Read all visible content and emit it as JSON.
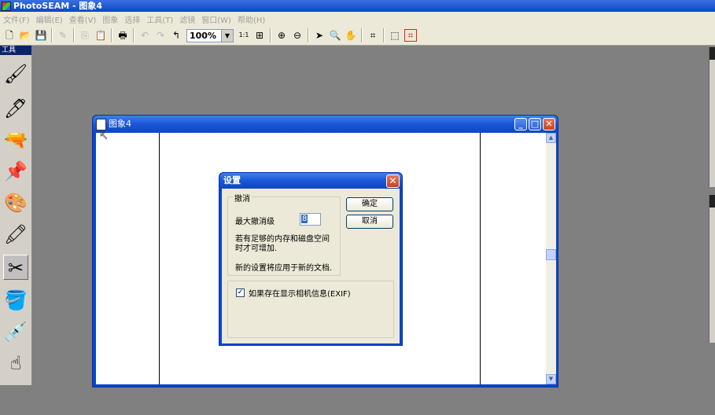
{
  "app": {
    "title": "PhotoSEAM - 图象4"
  },
  "menu": [
    "文件(F)",
    "编辑(E)",
    "查看(V)",
    "图象",
    "选择",
    "工具(T)",
    "滤镜",
    "窗口(W)",
    "帮助(H)"
  ],
  "toolbar": {
    "zoom": "100%",
    "actual_size_label": "1:1"
  },
  "tools_panel": {
    "title": "工具"
  },
  "document": {
    "title": "图象4"
  },
  "dialog": {
    "title": "设置",
    "undo_group": "撤消",
    "max_undo_label": "最大撤消级",
    "max_undo_value": "8",
    "note1_line1": "若有足够的内存和磁盘空间",
    "note1_line2": "时才可增加.",
    "note2": "新的设置将应用于新的文档.",
    "ok_label": "确定",
    "cancel_label": "取消",
    "exif_label": "如果存在显示相机信息(EXIF)",
    "exif_checked": true
  }
}
